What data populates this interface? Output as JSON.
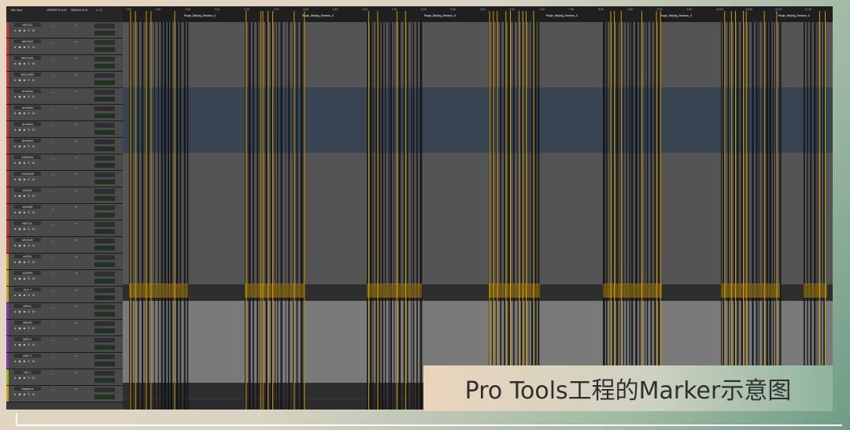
{
  "header": {
    "mix_label": "Mix Bus",
    "col_inserts": "INSERTS A-E",
    "col_sends": "SENDS A-E",
    "col_io": "I / O"
  },
  "tracks": [
    {
      "name": "MEZUL",
      "color": "#c23a3a"
    },
    {
      "name": "MEZUR",
      "color": "#c23a3a"
    },
    {
      "name": "MEZUBL",
      "color": "#c23a3a"
    },
    {
      "name": "MEZUBR",
      "color": "#c23a3a"
    },
    {
      "name": "Ambient",
      "color": "#c23a3a"
    },
    {
      "name": "Ambient",
      "color": "#c23a3a"
    },
    {
      "name": "Ambient",
      "color": "#c23a3a"
    },
    {
      "name": "Ambient",
      "color": "#c23a3a"
    },
    {
      "name": "LMANDL",
      "color": "#c23a3a"
    },
    {
      "name": "LMANDR",
      "color": "#c23a3a"
    },
    {
      "name": "AGMIL",
      "color": "#c23a3a"
    },
    {
      "name": "AGMIR",
      "color": "#c23a3a"
    },
    {
      "name": "MKZUL",
      "color": "#c23a3a"
    },
    {
      "name": "MKZUR",
      "color": "#c23a3a"
    },
    {
      "name": "AGRIL",
      "color": "#d0a020"
    },
    {
      "name": "AGRIR",
      "color": "#d0a020"
    },
    {
      "name": "Aux 1",
      "color": "#d0a020"
    },
    {
      "name": "MEHL",
      "color": "#7a3fb0"
    },
    {
      "name": "MEHR",
      "color": "#7a3fb0"
    },
    {
      "name": "MIDI 1",
      "color": "#7a3fb0"
    },
    {
      "name": "MIDI 2",
      "color": "#7a3fb0"
    },
    {
      "name": "Mix 1",
      "color": "#9ab020"
    },
    {
      "name": "Mainbus",
      "color": "#d0a020"
    }
  ],
  "ruler": {
    "times": [
      "1:00",
      "0:30",
      "1:00",
      "1:30",
      "2:00",
      "2:30",
      "3:00",
      "3:30",
      "4:00",
      "4:30",
      "5:00",
      "5:30",
      "6:00",
      "6:30",
      "7:00",
      "7:30",
      "8:00",
      "8:30",
      "9:00",
      "9:30",
      "10:00",
      "10:30",
      "11:00",
      "11:30"
    ],
    "markers": [
      "Ruqin_Beijing_Session_0",
      "Ruqin_Beijing_Session_0",
      "Ruqin_Beijing_Session_0",
      "Ruqin_Beijing_Session_0",
      "Ruqin_Beijing_Session_0",
      "Ruqin_Beijing_Session_0",
      "Ruqin_Beijing_Session_0"
    ]
  },
  "caption": "Pro Tools工程的Marker示意图",
  "colors": {
    "marker": "#f5b800",
    "clip_dark": "#111111",
    "lane_dark": "#545454",
    "lane_blue": "#384452",
    "lane_light": "#7a7a7a"
  }
}
